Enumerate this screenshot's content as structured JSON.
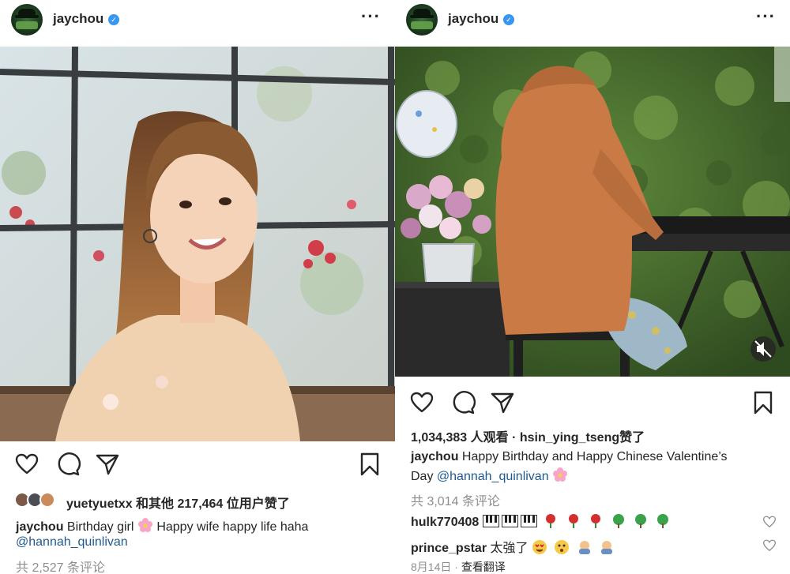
{
  "left_post": {
    "username": "jaychou",
    "likes_text": "yuetyuetxx 和其他 217,464 位用户赞了",
    "likes_user": "yuetyuetxx",
    "likes_rest": "和其他 217,464 位用户赞了",
    "caption_user": "jaychou",
    "caption_text_1": "Birthday girl",
    "caption_text_2": "Happy wife happy life haha",
    "mention": "@hannah_quinlivan",
    "comments_count": "共 2,527 条评论"
  },
  "right_post": {
    "username": "jaychou",
    "views_count": "1,034,383 人观看",
    "views_separator": "·",
    "liked_by_user": "hsin_ying_tseng",
    "liked_by_suffix": "赞了",
    "caption_user": "jaychou",
    "caption_text": "Happy Birthday and Happy Chinese Valentine’s",
    "caption_text_2": "Day",
    "mention": "@hannah_quinlivan",
    "comments_count": "共 3,014 条评论",
    "comments": [
      {
        "user": "hulk770408",
        "text": ""
      },
      {
        "user": "prince_pstar",
        "text": "太強了"
      }
    ],
    "date": "8月14日",
    "translate": "查看翻译"
  },
  "colors": {
    "verified": "#3897f0",
    "mention": "#1e5a8e",
    "muted": "#8e8e8e"
  },
  "icons": [
    "heart-icon",
    "comment-icon",
    "share-icon",
    "save-icon",
    "more-icon",
    "mute-icon",
    "verified-icon"
  ]
}
